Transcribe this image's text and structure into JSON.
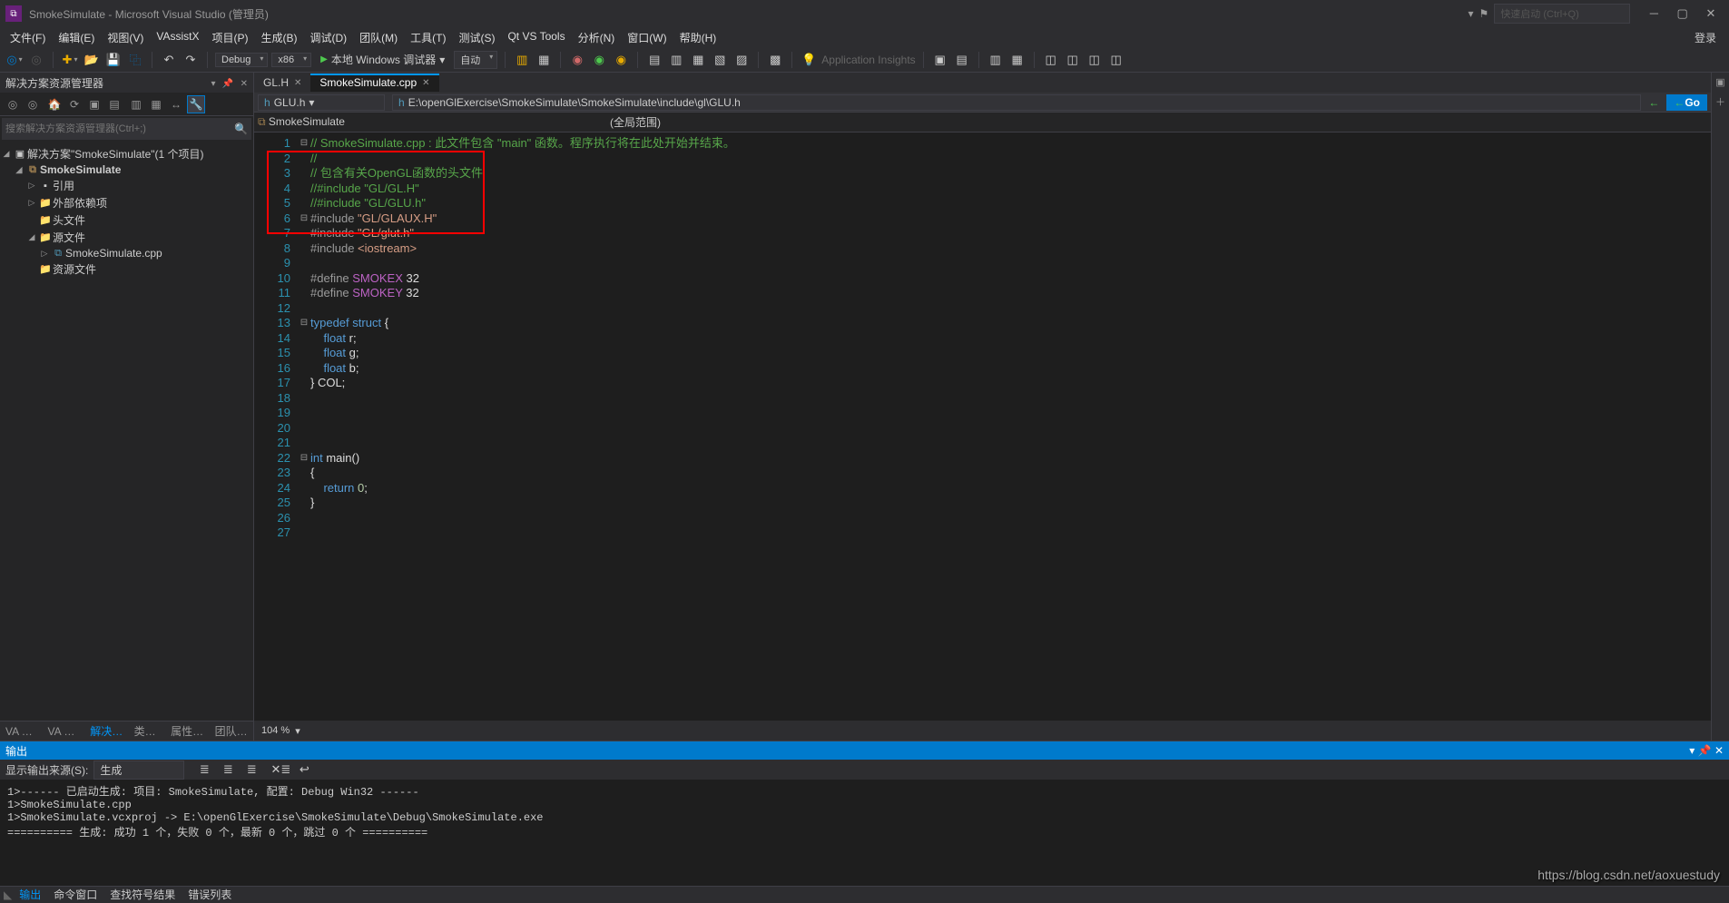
{
  "title": "SmokeSimulate - Microsoft Visual Studio (管理员)",
  "quick_launch": "快速启动 (Ctrl+Q)",
  "login": "登录",
  "menu": [
    "文件(F)",
    "编辑(E)",
    "视图(V)",
    "VAssistX",
    "项目(P)",
    "生成(B)",
    "调试(D)",
    "团队(M)",
    "工具(T)",
    "测试(S)",
    "Qt VS Tools",
    "分析(N)",
    "窗口(W)",
    "帮助(H)"
  ],
  "toolbar": {
    "config": "Debug",
    "platform": "x86",
    "debugger": "本地 Windows 调试器",
    "target": "自动",
    "insights": "Application Insights"
  },
  "solution_panel": {
    "title": "解决方案资源管理器",
    "search_placeholder": "搜索解决方案资源管理器(Ctrl+;)",
    "root": "解决方案\"SmokeSimulate\"(1 个项目)",
    "project": "SmokeSimulate",
    "nodes": [
      "引用",
      "外部依赖项",
      "头文件",
      "源文件",
      "资源文件"
    ],
    "source_file": "SmokeSimulate.cpp",
    "tabs": [
      "VA View",
      "VA Ou...",
      "解决方...",
      "类视图",
      "属性管...",
      "团队资..."
    ]
  },
  "doc_tabs": [
    "GL.H",
    "SmokeSimulate.cpp"
  ],
  "nav": {
    "file": "GLU.h",
    "path": "E:\\openGlExercise\\SmokeSimulate\\SmokeSimulate\\include\\gl\\GLU.h",
    "scope1": "SmokeSimulate",
    "scope2": "(全局范围)",
    "go": "Go"
  },
  "zoom": "104 %",
  "code": {
    "lines": [
      {
        "n": 1,
        "f": "⊟",
        "seg": [
          {
            "c": "c-comment",
            "t": "// SmokeSimulate.cpp : 此文件包含 \"main\" 函数。程序执行将在此处开始并结束。"
          }
        ]
      },
      {
        "n": 2,
        "f": "",
        "seg": [
          {
            "c": "c-comment",
            "t": "//"
          }
        ]
      },
      {
        "n": 3,
        "f": "",
        "seg": [
          {
            "c": "c-comment",
            "t": "// 包含有关OpenGL函数的头文件"
          }
        ]
      },
      {
        "n": 4,
        "f": "",
        "seg": [
          {
            "c": "c-comment",
            "t": "//#include \"GL/GL.H\""
          }
        ]
      },
      {
        "n": 5,
        "f": "",
        "seg": [
          {
            "c": "c-comment",
            "t": "//#include \"GL/GLU.h\""
          }
        ]
      },
      {
        "n": 6,
        "f": "⊟",
        "seg": [
          {
            "c": "c-pre",
            "t": "#include "
          },
          {
            "c": "c-string",
            "t": "\"GL/GLAUX.H\""
          }
        ]
      },
      {
        "n": 7,
        "f": "",
        "seg": [
          {
            "c": "c-pre",
            "t": "#include "
          },
          {
            "c": "c-string",
            "t": "\"GL/glut.h\""
          }
        ]
      },
      {
        "n": 8,
        "f": "",
        "seg": [
          {
            "c": "c-pre",
            "t": "#include "
          },
          {
            "c": "c-string",
            "t": "<iostream>"
          }
        ]
      },
      {
        "n": 9,
        "f": "",
        "seg": [
          {
            "c": "c-plain",
            "t": ""
          }
        ]
      },
      {
        "n": 10,
        "f": "",
        "seg": [
          {
            "c": "c-pre",
            "t": "#define "
          },
          {
            "c": "c-macro",
            "t": "SMOKEX"
          },
          {
            "c": "c-plain",
            "t": " 32"
          }
        ]
      },
      {
        "n": 11,
        "f": "",
        "seg": [
          {
            "c": "c-pre",
            "t": "#define "
          },
          {
            "c": "c-macro",
            "t": "SMOKEY"
          },
          {
            "c": "c-plain",
            "t": " 32"
          }
        ]
      },
      {
        "n": 12,
        "f": "",
        "seg": [
          {
            "c": "c-plain",
            "t": ""
          }
        ]
      },
      {
        "n": 13,
        "f": "⊟",
        "seg": [
          {
            "c": "c-keyword",
            "t": "typedef"
          },
          {
            "c": "c-plain",
            "t": " "
          },
          {
            "c": "c-keyword",
            "t": "struct"
          },
          {
            "c": "c-plain",
            "t": " {"
          }
        ]
      },
      {
        "n": 14,
        "f": "",
        "seg": [
          {
            "c": "c-plain",
            "t": "    "
          },
          {
            "c": "c-keyword",
            "t": "float"
          },
          {
            "c": "c-plain",
            "t": " r;"
          }
        ]
      },
      {
        "n": 15,
        "f": "",
        "seg": [
          {
            "c": "c-plain",
            "t": "    "
          },
          {
            "c": "c-keyword",
            "t": "float"
          },
          {
            "c": "c-plain",
            "t": " g;"
          }
        ]
      },
      {
        "n": 16,
        "f": "",
        "seg": [
          {
            "c": "c-plain",
            "t": "    "
          },
          {
            "c": "c-keyword",
            "t": "float"
          },
          {
            "c": "c-plain",
            "t": " b;"
          }
        ]
      },
      {
        "n": 17,
        "f": "",
        "seg": [
          {
            "c": "c-plain",
            "t": "} COL;"
          }
        ]
      },
      {
        "n": 18,
        "f": "",
        "seg": [
          {
            "c": "c-plain",
            "t": ""
          }
        ]
      },
      {
        "n": 19,
        "f": "",
        "seg": [
          {
            "c": "c-plain",
            "t": ""
          }
        ]
      },
      {
        "n": 20,
        "f": "",
        "seg": [
          {
            "c": "c-plain",
            "t": ""
          }
        ]
      },
      {
        "n": 21,
        "f": "",
        "seg": [
          {
            "c": "c-plain",
            "t": ""
          }
        ]
      },
      {
        "n": 22,
        "f": "⊟",
        "seg": [
          {
            "c": "c-keyword",
            "t": "int"
          },
          {
            "c": "c-plain",
            "t": " main()"
          }
        ]
      },
      {
        "n": 23,
        "f": "",
        "seg": [
          {
            "c": "c-plain",
            "t": "{"
          }
        ]
      },
      {
        "n": 24,
        "f": "",
        "seg": [
          {
            "c": "c-plain",
            "t": "    "
          },
          {
            "c": "c-keyword",
            "t": "return"
          },
          {
            "c": "c-plain",
            "t": " "
          },
          {
            "c": "c-num",
            "t": "0"
          },
          {
            "c": "c-plain",
            "t": ";"
          }
        ]
      },
      {
        "n": 25,
        "f": "",
        "seg": [
          {
            "c": "c-plain",
            "t": "}"
          }
        ]
      },
      {
        "n": 26,
        "f": "",
        "seg": [
          {
            "c": "c-plain",
            "t": ""
          }
        ]
      },
      {
        "n": 27,
        "f": "",
        "seg": [
          {
            "c": "c-plain",
            "t": ""
          }
        ]
      }
    ]
  },
  "output": {
    "title": "输出",
    "source_label": "显示输出来源(S):",
    "source": "生成",
    "lines": [
      "1>------ 已启动生成: 项目: SmokeSimulate, 配置: Debug Win32 ------",
      "1>SmokeSimulate.cpp",
      "1>SmokeSimulate.vcxproj -> E:\\openGlExercise\\SmokeSimulate\\Debug\\SmokeSimulate.exe",
      "========== 生成: 成功 1 个，失败 0 个，最新 0 个，跳过 0 个 =========="
    ]
  },
  "bottom_tabs": [
    "输出",
    "命令窗口",
    "查找符号结果",
    "错误列表"
  ],
  "watermark": "https://blog.csdn.net/aoxuestudy"
}
